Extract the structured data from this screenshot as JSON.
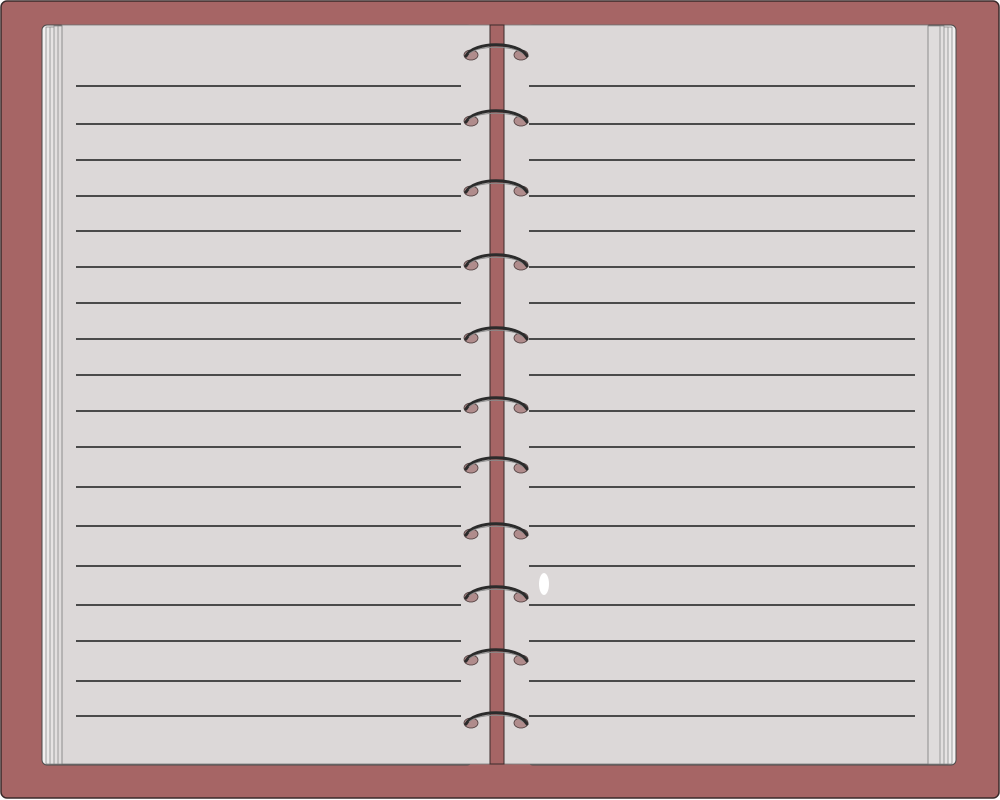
{
  "notebook": {
    "cover_color": "#a66565",
    "page_color": "#dcd8d8",
    "ruling_color": "#1a1a1a",
    "ring_color": "#2b2b2b",
    "ring_hole_color": "#b08c8c",
    "spine_color": "#a66565",
    "left_page": {
      "line_count": 18
    },
    "right_page": {
      "line_count": 18
    },
    "spiral_ring_count": 11
  }
}
